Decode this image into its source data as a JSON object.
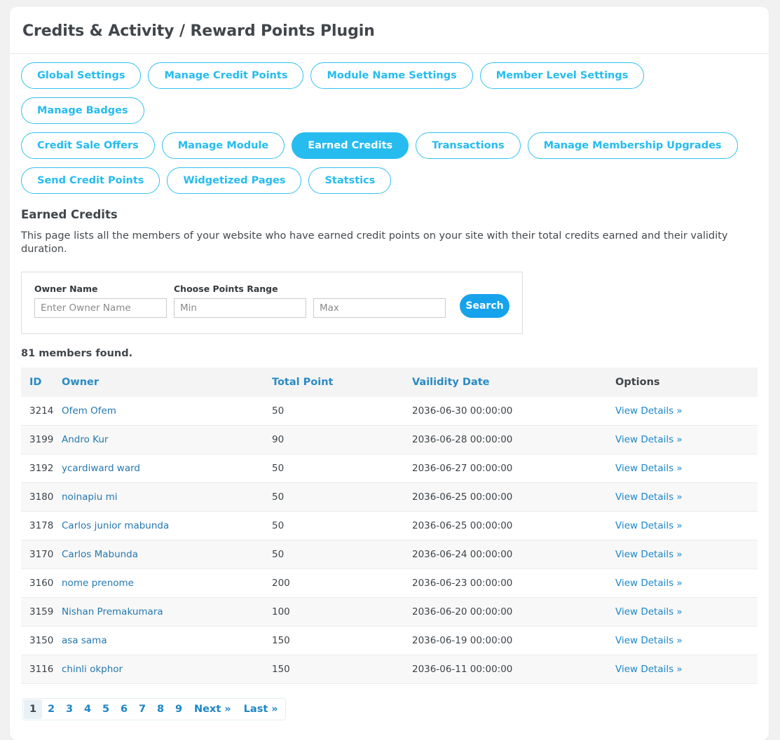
{
  "header": {
    "title": "Credits & Activity / Reward Points Plugin"
  },
  "tabs": [
    {
      "label": "Global Settings",
      "active": false
    },
    {
      "label": "Manage Credit Points",
      "active": false
    },
    {
      "label": "Module Name Settings",
      "active": false
    },
    {
      "label": "Member Level Settings",
      "active": false
    },
    {
      "label": "Manage Badges",
      "active": false
    },
    {
      "label": "Credit Sale Offers",
      "active": false
    },
    {
      "label": "Manage Module",
      "active": false
    },
    {
      "label": "Earned Credits",
      "active": true
    },
    {
      "label": "Transactions",
      "active": false
    },
    {
      "label": "Manage Membership Upgrades",
      "active": false
    },
    {
      "label": "Send Credit Points",
      "active": false
    },
    {
      "label": "Widgetized Pages",
      "active": false
    },
    {
      "label": "Statstics",
      "active": false
    }
  ],
  "section": {
    "title": "Earned Credits",
    "description": "This page lists all the members of your website who have earned credit points on your site with their total credits earned and their validity duration."
  },
  "search": {
    "owner_label": "Owner Name",
    "owner_placeholder": "Enter Owner Name",
    "owner_value": "",
    "range_label": "Choose Points Range",
    "min_placeholder": "Min",
    "min_value": "",
    "max_placeholder": "Max",
    "max_value": "",
    "button_label": "Search"
  },
  "results": {
    "count_text": "81 members found.",
    "columns": [
      "ID",
      "Owner",
      "Total Point",
      "Vailidity Date",
      "Options"
    ],
    "rows": [
      {
        "id": "3214",
        "owner": "Ofem Ofem",
        "total_point": "50",
        "validity_date": "2036-06-30 00:00:00",
        "option": "View Details »"
      },
      {
        "id": "3199",
        "owner": "Andro Kur",
        "total_point": "90",
        "validity_date": "2036-06-28 00:00:00",
        "option": "View Details »"
      },
      {
        "id": "3192",
        "owner": "ycardiward ward",
        "total_point": "50",
        "validity_date": "2036-06-27 00:00:00",
        "option": "View Details »"
      },
      {
        "id": "3180",
        "owner": "noinapiu mi",
        "total_point": "50",
        "validity_date": "2036-06-25 00:00:00",
        "option": "View Details »"
      },
      {
        "id": "3178",
        "owner": "Carlos junior mabunda",
        "total_point": "50",
        "validity_date": "2036-06-25 00:00:00",
        "option": "View Details »"
      },
      {
        "id": "3170",
        "owner": "Carlos Mabunda",
        "total_point": "50",
        "validity_date": "2036-06-24 00:00:00",
        "option": "View Details »"
      },
      {
        "id": "3160",
        "owner": "nome prenome",
        "total_point": "200",
        "validity_date": "2036-06-23 00:00:00",
        "option": "View Details »"
      },
      {
        "id": "3159",
        "owner": "Nishan Premakumara",
        "total_point": "100",
        "validity_date": "2036-06-20 00:00:00",
        "option": "View Details »"
      },
      {
        "id": "3150",
        "owner": "asa sama",
        "total_point": "150",
        "validity_date": "2036-06-19 00:00:00",
        "option": "View Details »"
      },
      {
        "id": "3116",
        "owner": "chinli okphor",
        "total_point": "150",
        "validity_date": "2036-06-11 00:00:00",
        "option": "View Details »"
      }
    ]
  },
  "pagination": {
    "pages": [
      "1",
      "2",
      "3",
      "4",
      "5",
      "6",
      "7",
      "8",
      "9"
    ],
    "current": "1",
    "next_label": "Next »",
    "last_label": "Last »"
  },
  "colors": {
    "accent_cyan": "#26bcf0",
    "button_blue": "#16a3ec",
    "link_blue": "#1c86c8",
    "owner_link": "#2578ae",
    "header_text": "#41464b",
    "table_header_bg": "#f4f4f4",
    "page_bg": "#f1f1f1"
  }
}
